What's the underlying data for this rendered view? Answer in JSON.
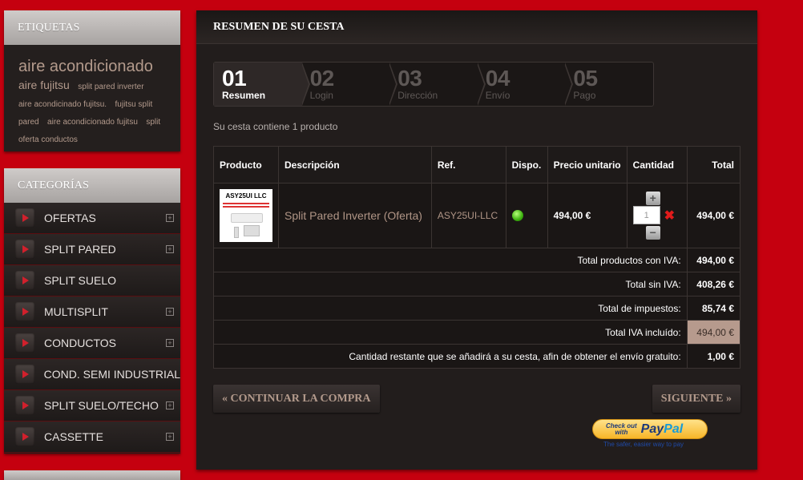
{
  "tags": {
    "title": "ETIQUETAS",
    "items": [
      {
        "text": "aire acondicionado",
        "size": "big"
      },
      {
        "text": "aire fujitsu",
        "size": "md"
      },
      {
        "text": "split pared inverter",
        "size": "sm"
      },
      {
        "text": "aire acondicinado fujitsu.",
        "size": "sm"
      },
      {
        "text": "fujitsu split pared",
        "size": "sm"
      },
      {
        "text": "aire acondicionado fujitsu",
        "size": "sm"
      },
      {
        "text": "split oferta conductos",
        "size": "sm"
      }
    ]
  },
  "categories": {
    "title": "CATEGORÍAS",
    "items": [
      {
        "label": "OFERTAS",
        "has_children": true
      },
      {
        "label": "SPLIT PARED",
        "has_children": true
      },
      {
        "label": "SPLIT SUELO",
        "has_children": false
      },
      {
        "label": "MULTISPLIT",
        "has_children": true
      },
      {
        "label": "CONDUCTOS",
        "has_children": true
      },
      {
        "label": "COND. SEMI INDUSTRIAL",
        "has_children": false
      },
      {
        "label": "SPLIT SUELO/TECHO",
        "has_children": true
      },
      {
        "label": "CASSETTE",
        "has_children": true
      }
    ]
  },
  "main": {
    "title": "RESUMEN DE SU CESTA",
    "steps": [
      {
        "num": "01",
        "label": "Resumen",
        "active": true
      },
      {
        "num": "02",
        "label": "Login",
        "active": false
      },
      {
        "num": "03",
        "label": "Dirección",
        "active": false
      },
      {
        "num": "04",
        "label": "Envío",
        "active": false
      },
      {
        "num": "05",
        "label": "Pago",
        "active": false
      }
    ],
    "summary_text": "Su cesta contiene 1 producto",
    "table": {
      "headers": {
        "product": "Producto",
        "description": "Descripción",
        "ref": "Ref.",
        "avail": "Dispo.",
        "unit_price": "Precio unitario",
        "qty": "Cantidad",
        "total": "Total"
      },
      "row": {
        "image_brand": "ASY25UI LLC",
        "description": "Split Pared Inverter (Oferta)",
        "ref": "ASY25UI-LLC",
        "unit_price": "494,00 €",
        "qty": "1",
        "qty_up": "+",
        "qty_down": "−",
        "remove_icon": "✖",
        "total": "494,00 €"
      },
      "totals": [
        {
          "label": "Total productos con IVA:",
          "value": "494,00 €",
          "highlight": false
        },
        {
          "label": "Total sin IVA:",
          "value": "408,26 €",
          "highlight": false
        },
        {
          "label": "Total de impuestos:",
          "value": "85,74 €",
          "highlight": false
        },
        {
          "label": "Total IVA incluído:",
          "value": "494,00 €",
          "highlight": true
        },
        {
          "label": "Cantidad restante que se añadirá a su cesta, afin de obtener el envío gratuito:",
          "value": "1,00 €",
          "highlight": false
        }
      ]
    },
    "buttons": {
      "continue": "« CONTINUAR LA COMPRA",
      "next": "SIGUIENTE »"
    },
    "paypal": {
      "check_line1": "Check out",
      "check_line2": "with",
      "logo_a": "Pay",
      "logo_b": "Pal",
      "sub": "The safer, easier way to pay"
    }
  },
  "colors": {
    "background": "#c5000f",
    "panel": "#221d1c",
    "accent_text": "#b39a8c",
    "highlight_cell": "#b69a8d",
    "available": "#3cb10e"
  }
}
